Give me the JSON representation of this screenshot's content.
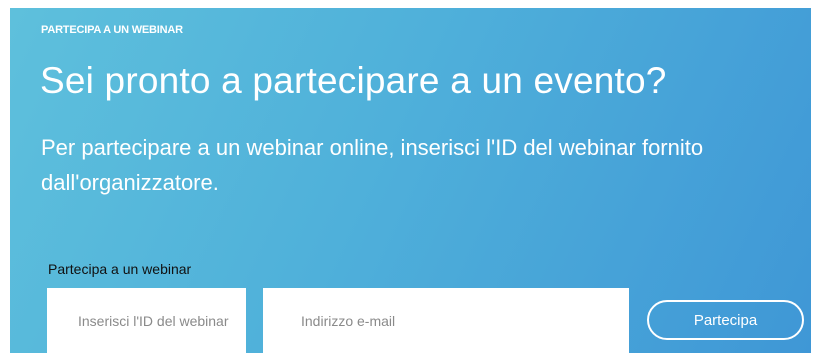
{
  "hero": {
    "eyebrow": "PARTECIPA A UN WEBINAR",
    "headline": "Sei pronto a partecipare a un evento?",
    "description": "Per partecipare a un webinar online, inserisci l'ID del webinar fornito dall'organizzatore."
  },
  "form": {
    "label": "Partecipa a un webinar",
    "webinar_id": {
      "placeholder": "Inserisci l'ID del webinar",
      "value": ""
    },
    "email": {
      "placeholder": "Indirizzo e-mail",
      "value": ""
    },
    "submit_label": "Partecipa"
  },
  "colors": {
    "gradient_start": "#5ec0dc",
    "gradient_end": "#3f97d6",
    "text": "#ffffff",
    "label_text": "#111111"
  }
}
